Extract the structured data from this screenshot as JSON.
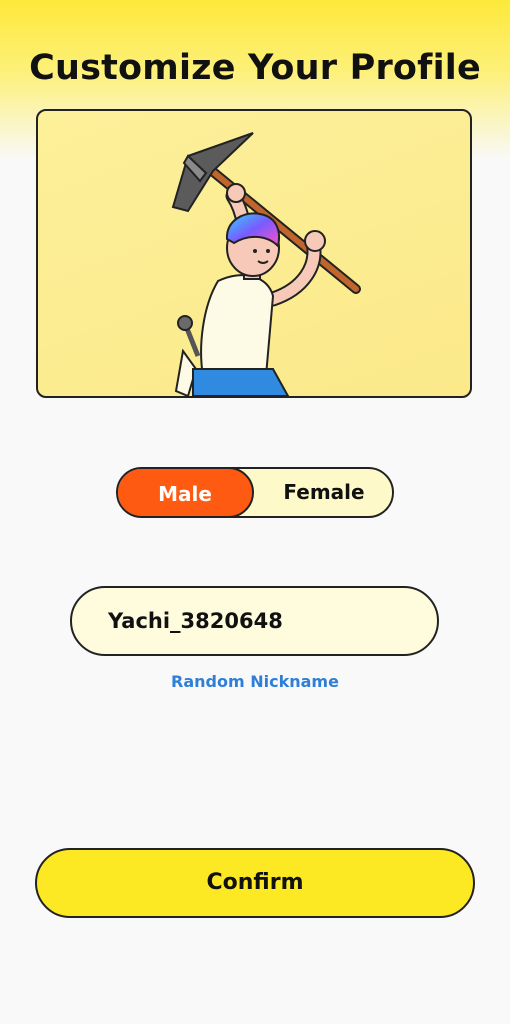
{
  "header": {
    "title": "Customize Your Profile"
  },
  "avatar": {
    "illustration": "character-with-pickaxe"
  },
  "gender": {
    "options": [
      "Male",
      "Female"
    ],
    "selected": "Male"
  },
  "nickname": {
    "value": "Yachi_3820648",
    "random_label": "Random Nickname"
  },
  "actions": {
    "confirm_label": "Confirm"
  },
  "colors": {
    "accent_yellow": "#fde824",
    "selected_orange": "#ff5a12",
    "link_blue": "#2f7fd8"
  }
}
